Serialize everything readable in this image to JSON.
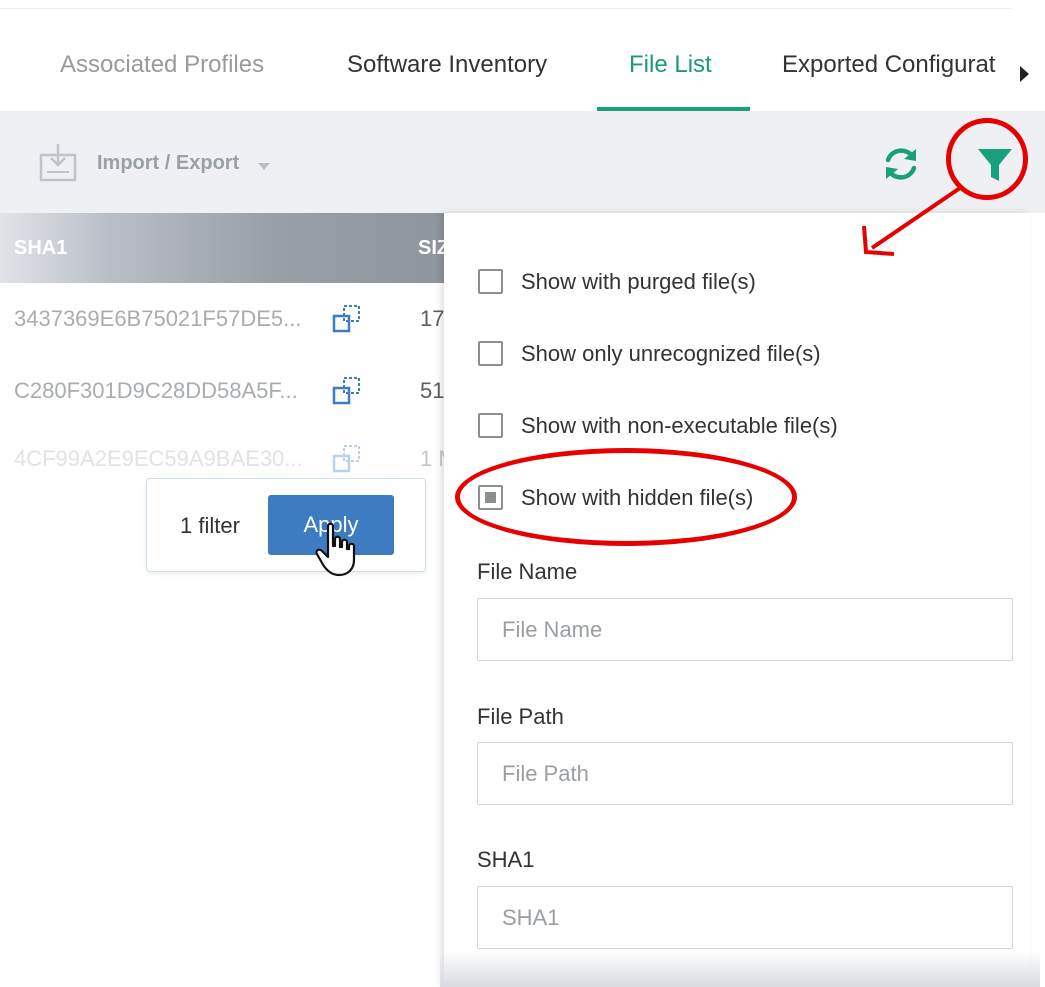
{
  "tabs": [
    {
      "label": "Associated Profiles",
      "state": "inactive"
    },
    {
      "label": "Software Inventory",
      "state": "normal"
    },
    {
      "label": "File List",
      "state": "active"
    },
    {
      "label": "Exported Configurat",
      "state": "normal"
    }
  ],
  "toolbar": {
    "import_export_label": "Import / Export",
    "icons": [
      "import-export-icon",
      "refresh-icon",
      "filter-icon"
    ]
  },
  "table": {
    "columns": [
      "SHA1",
      "SIZ"
    ],
    "rows": [
      {
        "sha1": "3437369E6B75021F57DE5...",
        "size": "17"
      },
      {
        "sha1": "C280F301D9C28DD58A5F...",
        "size": "51"
      },
      {
        "sha1": "4CF99A2E9EC59A9BAE30...",
        "size": "1 M"
      }
    ]
  },
  "apply_popup": {
    "filter_count": "1 filter",
    "apply_label": "Apply"
  },
  "filter_panel": {
    "options": [
      {
        "label": "Show with purged file(s)",
        "checked": false
      },
      {
        "label": "Show only unrecognized file(s)",
        "checked": false
      },
      {
        "label": "Show with non-executable file(s)",
        "checked": false
      },
      {
        "label": "Show with hidden file(s)",
        "checked": true
      }
    ],
    "fields": [
      {
        "label": "File Name",
        "placeholder": "File Name"
      },
      {
        "label": "File Path",
        "placeholder": "File Path"
      },
      {
        "label": "SHA1",
        "placeholder": "SHA1"
      }
    ]
  },
  "colors": {
    "accent": "#17a07c",
    "apply_button": "#3e7cc1",
    "annotation": "#e60000",
    "toolbar_bg": "#eef0f3"
  }
}
